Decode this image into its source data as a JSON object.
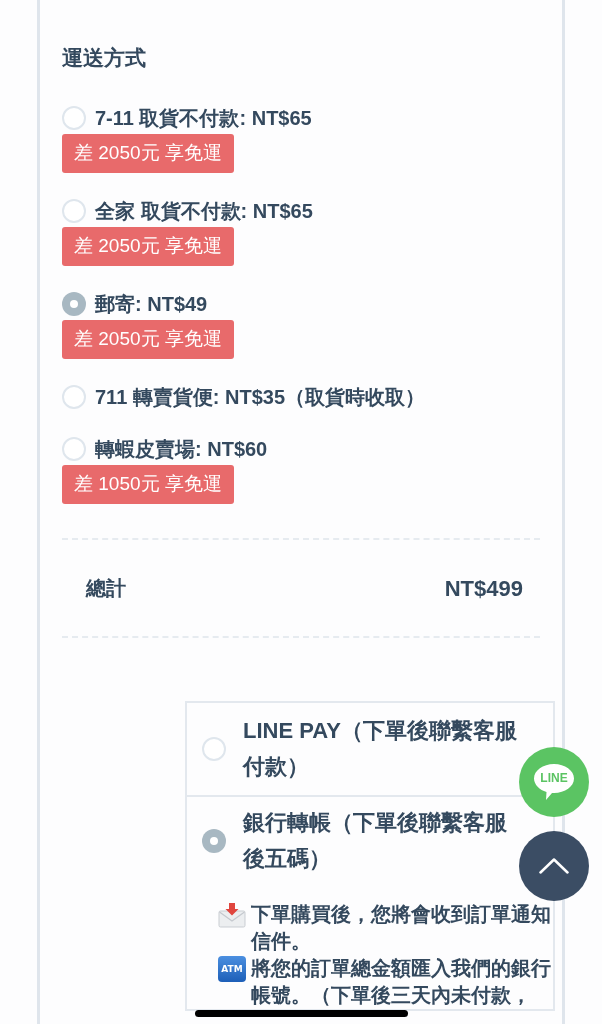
{
  "shipping": {
    "title": "運送方式",
    "options": [
      {
        "label": "7-11 取貨不付款: NT$65",
        "selected": false,
        "badge": "差 2050元 享免運"
      },
      {
        "label": "全家 取貨不付款: NT$65",
        "selected": false,
        "badge": "差 2050元 享免運"
      },
      {
        "label": "郵寄: NT$49",
        "selected": true,
        "badge": "差 2050元 享免運"
      },
      {
        "label": "711 轉賣貨便: NT$35（取貨時收取）",
        "selected": false
      },
      {
        "label": "轉蝦皮賣場: NT$60",
        "selected": false,
        "badge": "差 1050元 享免運"
      }
    ]
  },
  "total": {
    "label": "總計",
    "value": "NT$499"
  },
  "payment": {
    "options": [
      {
        "label": "LINE PAY（下單後聯繫客服付款）",
        "selected": false
      },
      {
        "label": "銀行轉帳（下單後聯繫客服後五碼）",
        "selected": true,
        "details": [
          {
            "kind": "envelope",
            "text": "下單購買後，您將會收到訂單通知信件。"
          },
          {
            "kind": "atm",
            "icon_text": "ATM",
            "text": "將您的訂單總金額匯入我們的銀行帳號。（下單後三天內未付款，"
          }
        ]
      }
    ]
  },
  "floating_buttons": [
    {
      "kind": "line",
      "label": "LINE"
    },
    {
      "kind": "back_to_top"
    }
  ]
}
